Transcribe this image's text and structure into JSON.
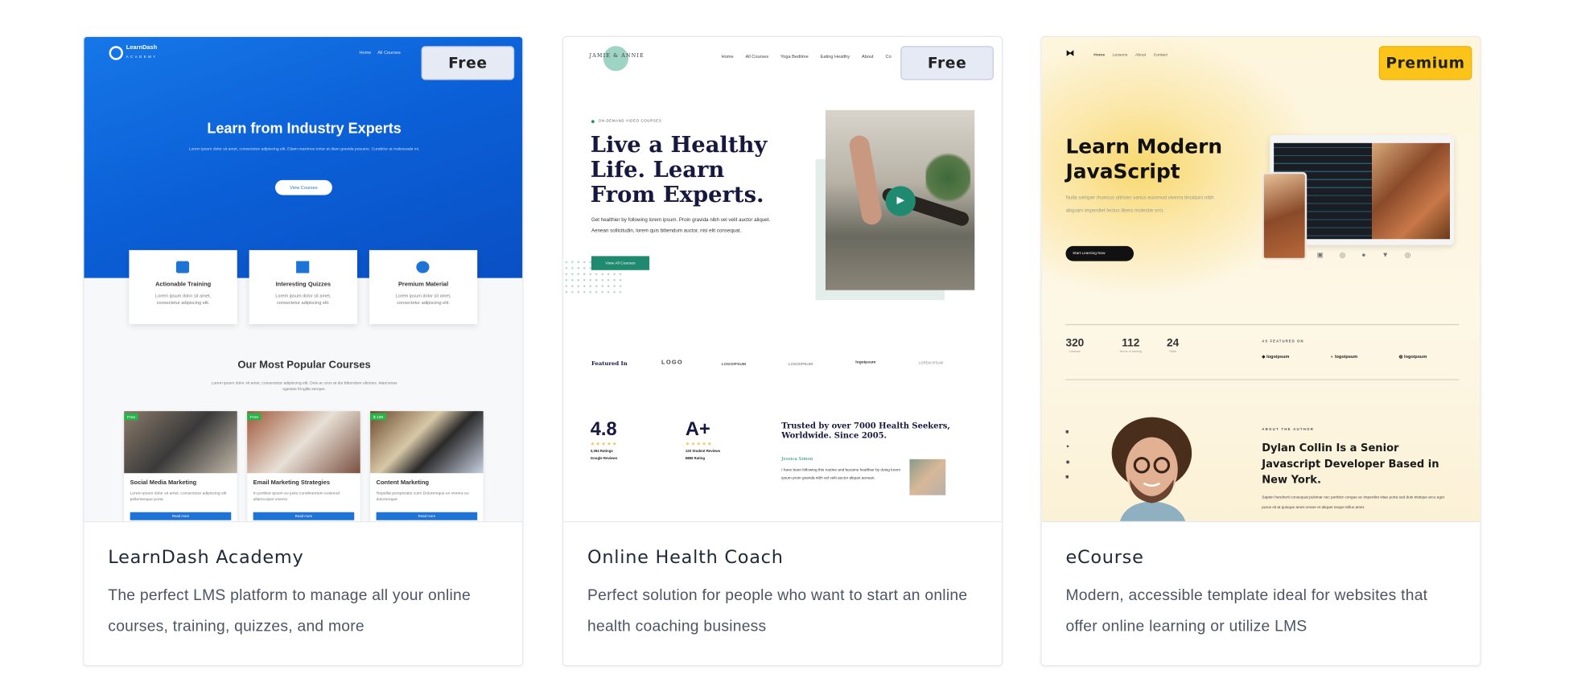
{
  "cards": [
    {
      "title": "LearnDash Academy",
      "description": "The perfect LMS platform to manage all your online courses, training, quizzes, and more",
      "badge": "Free",
      "preview": {
        "logo": "LearnDash",
        "logo_sub": "ACADEMY",
        "nav": [
          "Home",
          "All Courses"
        ],
        "hero_title": "Learn from Industry Experts",
        "hero_text": "Lorem ipsum dolor sit amet, consectetur adipiscing elit. Etiam maximus tortor at diam gravida posuere. Curabitur at malesuada mi.",
        "hero_button": "View Courses",
        "features": [
          {
            "title": "Actionable Training",
            "text": "Lorem ipsum dolor sit amet, consectetur adipiscing elit."
          },
          {
            "title": "Interesting Quizzes",
            "text": "Lorem ipsum dolor sit amet, consectetur adipiscing elit."
          },
          {
            "title": "Premium Material",
            "text": "Lorem ipsum dolor sit amet, consectetur adipiscing elit."
          }
        ],
        "section_title": "Our Most Popular Courses",
        "section_text": "Lorem ipsum dolor sit amet, consectetur adipiscing elit. Duis ac eros at dui bibendum ultricies. Maecenas egestas fringilla semper.",
        "courses": [
          {
            "title": "Social Media Marketing",
            "tag": "Free",
            "text": "Lorem ipsum dolor sit amet, consectetur adipiscing elit pellentesque porta",
            "button": "Read more"
          },
          {
            "title": "Email Marketing Strategies",
            "tag": "Free",
            "text": "In porttitor ipsum eu justo condimentum euismod ullamcorper viverra",
            "button": "Read more"
          },
          {
            "title": "Content Marketing",
            "tag": "$ 100",
            "text": "Repellat perspiciatis cum! Doloremque ex viverra eu doloremque",
            "button": "Read more"
          }
        ]
      }
    },
    {
      "title": "Online Health Coach",
      "description": "Perfect solution for people who want to start an online health coaching business",
      "badge": "Free",
      "preview": {
        "logo": "JAMIE & ANNIE",
        "nav": [
          "Home",
          "All Courses",
          "Yoga Bedtime",
          "Eating Healthy",
          "About",
          "Co"
        ],
        "eyebrow": "ON-DEMAND VIDEO COURSES",
        "hero_title": "Live a Healthy Life. Learn From Experts.",
        "hero_text": "Get healthier by following lorem ipsum. Proin gravida nibh vel velit auctor aliquet. Aenean sollicitudin, lorem quis bibendum auctor, nisi elit consequat.",
        "hero_button": "View All Courses",
        "featured_label": "Featured In",
        "featured_logos": [
          "LOGO",
          "LOGOIPSUM",
          "LOGOIPSUM",
          "logoipsum",
          "LOREM IPSUM"
        ],
        "stats": [
          {
            "value": "4.8",
            "line1": "3,394 Ratings",
            "line2": "Google Reviews"
          },
          {
            "value": "A+",
            "line1": "120 Student Reviews",
            "line2": "BBB Rating"
          }
        ],
        "trusted": "Trusted by over 7000 Health Seekers, Worldwide. Since 2005.",
        "reviewer": "Jessica Simon",
        "review": "I have been following this routine and became healthier by doing lorem ipsum proin gravida nibh vel velit auctor aliquet aenean."
      }
    },
    {
      "title": "eCourse",
      "description": "Modern, accessible template ideal for websites that offer online learning or utilize LMS",
      "badge": "Premium",
      "preview": {
        "nav": [
          "Home",
          "Lessons",
          "About",
          "Contact"
        ],
        "hero_title": "Learn Modern JavaScript",
        "hero_text": "Nulla semper rhoncus ultrices varius euismod viverra tincidunt nibh aliquam imperdiet lectus libero molestie orci.",
        "hero_button": "Start Learning Now",
        "stats": [
          {
            "value": "320",
            "label": "Lessons"
          },
          {
            "value": "112",
            "label": "Hours of training"
          },
          {
            "value": "24",
            "label": "Skills"
          }
        ],
        "featured_label": "AS FEATURED ON",
        "featured_logos": [
          "logoipsum",
          "logoipsum",
          "logoipsum"
        ],
        "about_label": "ABOUT THE AUTHOR",
        "about_title": "Dylan Collin Is a Senior Javascript Developer Based in New York.",
        "about_text": "Sapien hendrerit consequat pulvinar nec porttitor congue ac imperdiet vitae porta sed duis tristique arcu eget purus sit at quisque amet ornare et aliquet neque tellus amet."
      }
    }
  ],
  "colors": {
    "free_badge": "#e6eaf5",
    "premium_badge": "#fcc419",
    "learndash_blue": "#0b5fd6",
    "health_teal": "#1f8a70",
    "ecourse_yellow": "#f8d86e"
  }
}
